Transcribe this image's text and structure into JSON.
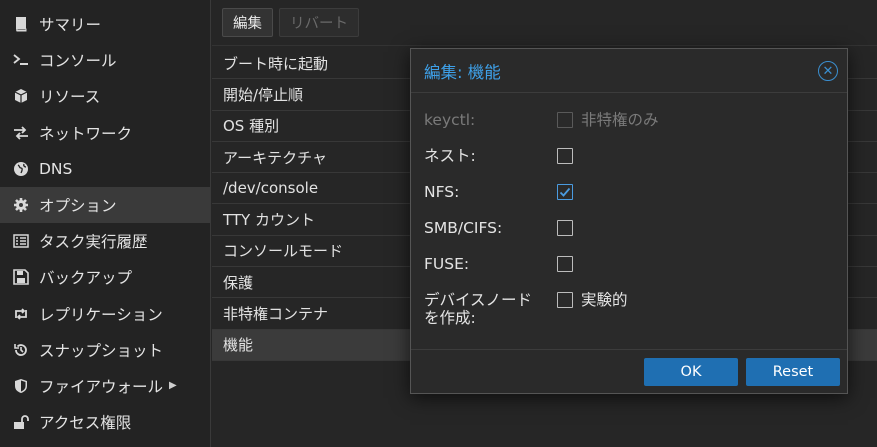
{
  "sidebar": {
    "items": [
      {
        "label": "サマリー",
        "icon": "book-icon"
      },
      {
        "label": "コンソール",
        "icon": "terminal-icon"
      },
      {
        "label": "リソース",
        "icon": "cube-icon"
      },
      {
        "label": "ネットワーク",
        "icon": "exchange-icon"
      },
      {
        "label": "DNS",
        "icon": "globe-icon"
      },
      {
        "label": "オプション",
        "icon": "gear-icon"
      },
      {
        "label": "タスク実行履歴",
        "icon": "list-icon"
      },
      {
        "label": "バックアップ",
        "icon": "floppy-icon"
      },
      {
        "label": "レプリケーション",
        "icon": "retweet-icon"
      },
      {
        "label": "スナップショット",
        "icon": "history-icon"
      },
      {
        "label": "ファイアウォール",
        "icon": "shield-icon"
      },
      {
        "label": "アクセス権限",
        "icon": "unlock-icon"
      }
    ]
  },
  "toolbar": {
    "edit_label": "編集",
    "revert_label": "リバート"
  },
  "options": {
    "rows": [
      "ブート時に起動",
      "開始/停止順",
      "OS 種別",
      "アーキテクチャ",
      "/dev/console",
      "TTY カウント",
      "コンソールモード",
      "保護",
      "非特権コンテナ",
      "機能"
    ]
  },
  "dialog": {
    "title": "編集: 機能",
    "fields": {
      "keyctl": {
        "label": "keyctl:",
        "checkbox_text": "非特権のみ",
        "checked": false,
        "disabled": true
      },
      "nesting": {
        "label": "ネスト:",
        "checked": false
      },
      "nfs": {
        "label": "NFS:",
        "checked": true
      },
      "smb": {
        "label": "SMB/CIFS:",
        "checked": false
      },
      "fuse": {
        "label": "FUSE:",
        "checked": false
      },
      "mknod": {
        "label_line1": "デバイスノード",
        "label_line2": "を作成:",
        "checkbox_text": "実験的",
        "checked": false
      }
    },
    "ok_label": "OK",
    "reset_label": "Reset"
  },
  "colors": {
    "accent": "#3ea0e8",
    "button": "#1f6fb2",
    "background": "#262626"
  }
}
